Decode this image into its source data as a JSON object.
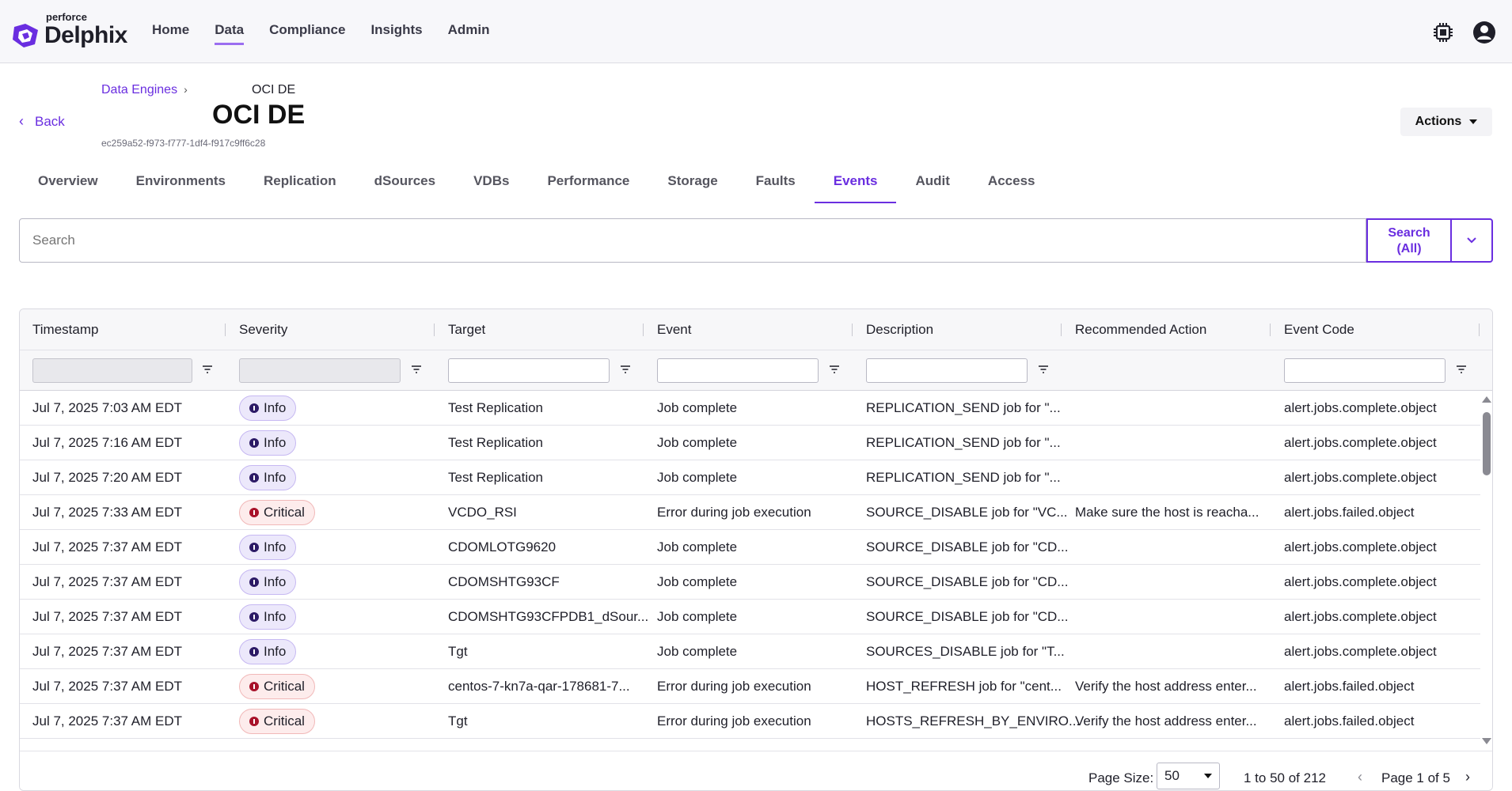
{
  "brand": {
    "top": "perforce",
    "main": "Delphix",
    "color": "#6a2ee0"
  },
  "nav": [
    {
      "label": "Home",
      "active": false
    },
    {
      "label": "Data",
      "active": true
    },
    {
      "label": "Compliance",
      "active": false
    },
    {
      "label": "Insights",
      "active": false
    },
    {
      "label": "Admin",
      "active": false
    }
  ],
  "top_icons": [
    "chip-icon",
    "user-account-icon"
  ],
  "header": {
    "back_label": "Back",
    "breadcrumb_parent": "Data Engines",
    "breadcrumb_current": "OCI DE",
    "title": "OCI DE",
    "id": "ec259a52-f973-f777-1df4-f917c9ff6c28",
    "actions_label": "Actions"
  },
  "tabs": [
    {
      "label": "Overview",
      "active": false
    },
    {
      "label": "Environments",
      "active": false
    },
    {
      "label": "Replication",
      "active": false
    },
    {
      "label": "dSources",
      "active": false
    },
    {
      "label": "VDBs",
      "active": false
    },
    {
      "label": "Performance",
      "active": false
    },
    {
      "label": "Storage",
      "active": false
    },
    {
      "label": "Faults",
      "active": false
    },
    {
      "label": "Events",
      "active": true
    },
    {
      "label": "Audit",
      "active": false
    },
    {
      "label": "Access",
      "active": false
    }
  ],
  "search": {
    "placeholder": "Search",
    "button_line1": "Search",
    "button_line2": "(All)"
  },
  "grid": {
    "columns": [
      "Timestamp",
      "Severity",
      "Target",
      "Event",
      "Description",
      "Recommended Action",
      "Event Code"
    ],
    "rows": [
      {
        "timestamp": "Jul 7, 2025 7:03 AM EDT",
        "severity": "Info",
        "target": "Test Replication",
        "event": "Job complete",
        "description": "REPLICATION_SEND job for \"...",
        "action": "",
        "code": "alert.jobs.complete.object"
      },
      {
        "timestamp": "Jul 7, 2025 7:16 AM EDT",
        "severity": "Info",
        "target": "Test Replication",
        "event": "Job complete",
        "description": "REPLICATION_SEND job for \"...",
        "action": "",
        "code": "alert.jobs.complete.object"
      },
      {
        "timestamp": "Jul 7, 2025 7:20 AM EDT",
        "severity": "Info",
        "target": "Test Replication",
        "event": "Job complete",
        "description": "REPLICATION_SEND job for \"...",
        "action": "",
        "code": "alert.jobs.complete.object"
      },
      {
        "timestamp": "Jul 7, 2025 7:33 AM EDT",
        "severity": "Critical",
        "target": "VCDO_RSI",
        "event": "Error during job execution",
        "description": "SOURCE_DISABLE job for \"VC...",
        "action": "Make sure the host is reacha...",
        "code": "alert.jobs.failed.object"
      },
      {
        "timestamp": "Jul 7, 2025 7:37 AM EDT",
        "severity": "Info",
        "target": "CDOMLOTG9620",
        "event": "Job complete",
        "description": "SOURCE_DISABLE job for \"CD...",
        "action": "",
        "code": "alert.jobs.complete.object"
      },
      {
        "timestamp": "Jul 7, 2025 7:37 AM EDT",
        "severity": "Info",
        "target": "CDOMSHTG93CF",
        "event": "Job complete",
        "description": "SOURCE_DISABLE job for \"CD...",
        "action": "",
        "code": "alert.jobs.complete.object"
      },
      {
        "timestamp": "Jul 7, 2025 7:37 AM EDT",
        "severity": "Info",
        "target": "CDOMSHTG93CFPDB1_dSour...",
        "event": "Job complete",
        "description": "SOURCE_DISABLE job for \"CD...",
        "action": "",
        "code": "alert.jobs.complete.object"
      },
      {
        "timestamp": "Jul 7, 2025 7:37 AM EDT",
        "severity": "Info",
        "target": "Tgt",
        "event": "Job complete",
        "description": "SOURCES_DISABLE job for \"T...",
        "action": "",
        "code": "alert.jobs.complete.object"
      },
      {
        "timestamp": "Jul 7, 2025 7:37 AM EDT",
        "severity": "Critical",
        "target": "centos-7-kn7a-qar-178681-7...",
        "event": "Error during job execution",
        "description": "HOST_REFRESH job for \"cent...",
        "action": "Verify the host address enter...",
        "code": "alert.jobs.failed.object"
      },
      {
        "timestamp": "Jul 7, 2025 7:37 AM EDT",
        "severity": "Critical",
        "target": "Tgt",
        "event": "Error during job execution",
        "description": "HOSTS_REFRESH_BY_ENVIRO...",
        "action": "Verify the host address enter...",
        "code": "alert.jobs.failed.object"
      }
    ]
  },
  "pager": {
    "size_label": "Page Size:",
    "size_value": "50",
    "range": "1 to 50 of 212",
    "page": "Page 1 of 5"
  }
}
